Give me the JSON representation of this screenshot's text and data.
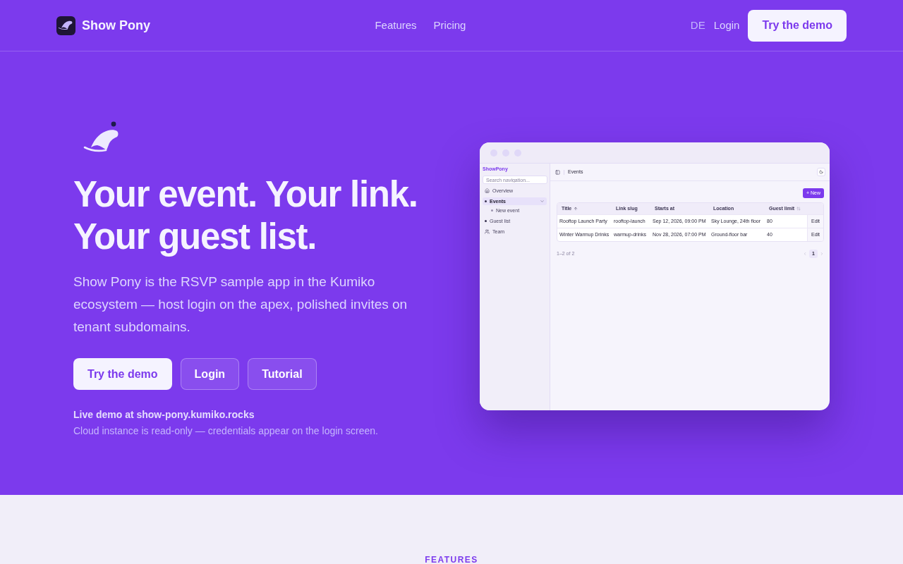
{
  "nav": {
    "brand": "Show Pony",
    "links": [
      {
        "label": "Features"
      },
      {
        "label": "Pricing"
      }
    ],
    "language": "DE",
    "login": "Login",
    "cta": "Try the demo"
  },
  "hero": {
    "headline": "Your event. Your link. Your guest list.",
    "description": "Show Pony is the RSVP sample app in the Kumiko ecosystem — host login on the apex, polished invites on tenant subdomains.",
    "buttons": [
      {
        "label": "Try the demo",
        "kind": "primary"
      },
      {
        "label": "Login",
        "kind": "outline"
      },
      {
        "label": "Tutorial",
        "kind": "outline"
      }
    ],
    "demo_note": "Live demo at show-pony.kumiko.rocks",
    "demo_subnote": "Cloud instance is read-only — credentials appear on the login screen."
  },
  "app_preview": {
    "sidebar": {
      "brand": "ShowPony",
      "search": {
        "placeholder": "Search navigation..."
      },
      "items": [
        {
          "label": "Overview",
          "kind": "home",
          "selected": false
        },
        {
          "label": "Events",
          "kind": "bullet",
          "selected": true,
          "expanded": true,
          "children": [
            {
              "label": "New event",
              "kind": "bullet",
              "selected": false
            }
          ]
        },
        {
          "label": "Guest list",
          "kind": "bullet",
          "selected": false
        },
        {
          "label": "Team",
          "kind": "people",
          "selected": false
        }
      ]
    },
    "breadcrumb": "Events",
    "new_button": "+ New",
    "table": {
      "columns": [
        {
          "label": "Title",
          "kind": "sorted"
        },
        {
          "label": "Link slug",
          "kind": "plain"
        },
        {
          "label": "Starts at",
          "kind": "plain"
        },
        {
          "label": "Location",
          "kind": "plain"
        },
        {
          "label": "Guest limit",
          "kind": "sortable"
        }
      ],
      "rows": [
        {
          "cells": [
            "Rooftop Launch Party",
            "rooftop-launch",
            "Sep 12, 2026, 09:00 PM",
            "Sky Lounge, 24th floor",
            "80"
          ],
          "action": "Edit"
        },
        {
          "cells": [
            "Winter Warmup Drinks",
            "warmup-drinks",
            "Nov 28, 2026, 07:00 PM",
            "Ground-floor bar",
            "40"
          ],
          "action": "Edit"
        }
      ]
    },
    "pagination": {
      "summary": "1–2 of 2",
      "pages": [
        {
          "label": "1",
          "selected": true
        }
      ]
    }
  },
  "features_section": {
    "eyebrow": "FEATURES"
  }
}
